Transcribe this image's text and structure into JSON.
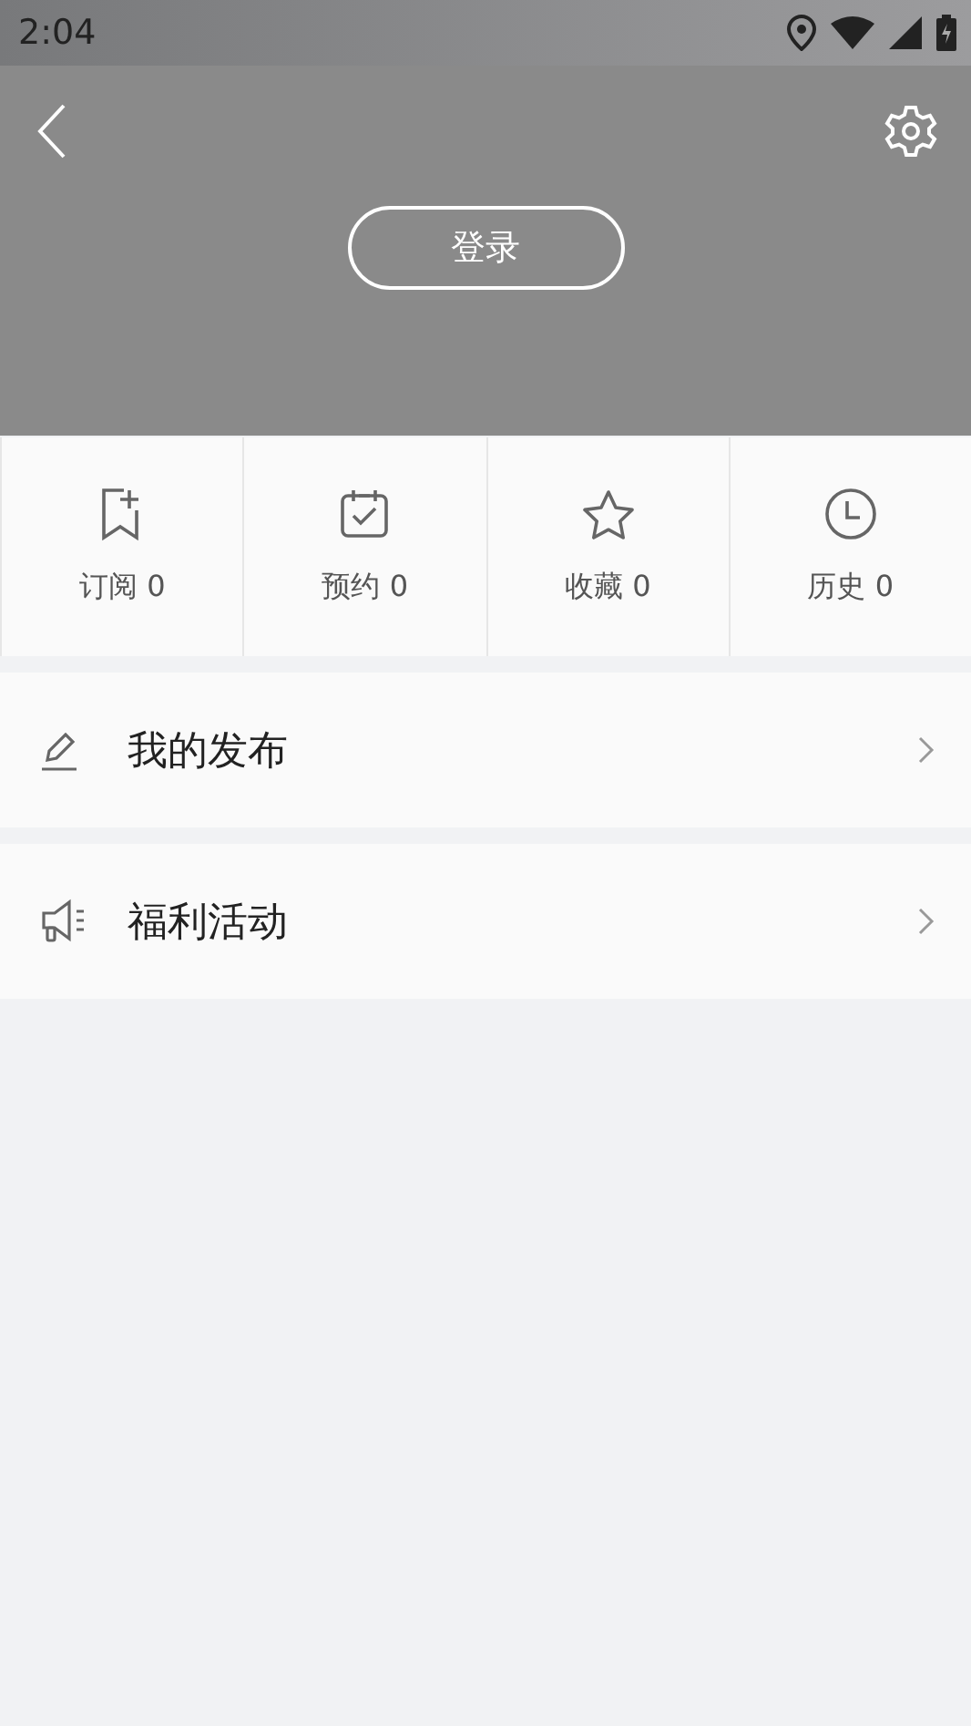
{
  "status_bar": {
    "time": "2:04"
  },
  "header": {
    "login_button": "登录"
  },
  "stats": [
    {
      "kind": "subscribe",
      "label": "订阅",
      "count": "0"
    },
    {
      "kind": "booking",
      "label": "预约",
      "count": "0"
    },
    {
      "kind": "favorite",
      "label": "收藏",
      "count": "0"
    },
    {
      "kind": "history",
      "label": "历史",
      "count": "0"
    }
  ],
  "menu": [
    {
      "kind": "publish",
      "label": "我的发布"
    },
    {
      "kind": "promo",
      "label": "福利活动"
    }
  ]
}
